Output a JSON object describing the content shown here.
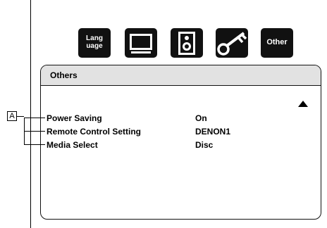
{
  "tabs": {
    "language": {
      "line1": "Lang",
      "line2": "uage",
      "icon": "language-icon"
    },
    "display": {
      "icon": "monitor-icon"
    },
    "audio": {
      "icon": "speaker-icon"
    },
    "ratings": {
      "icon": "key-icon"
    },
    "other": {
      "label": "Other",
      "icon": "other-icon"
    }
  },
  "panel": {
    "title": "Others",
    "rows": [
      {
        "label": "Power Saving",
        "value": "On"
      },
      {
        "label": "Remote Control Setting",
        "value": "DENON1"
      },
      {
        "label": "Media Select",
        "value": "Disc"
      }
    ],
    "scroll_icon": "up-arrow-icon"
  },
  "callout": {
    "label": "A"
  },
  "colors": {
    "tab_bg": "#111111",
    "header_bg": "#e2e2e2",
    "text": "#000000"
  }
}
